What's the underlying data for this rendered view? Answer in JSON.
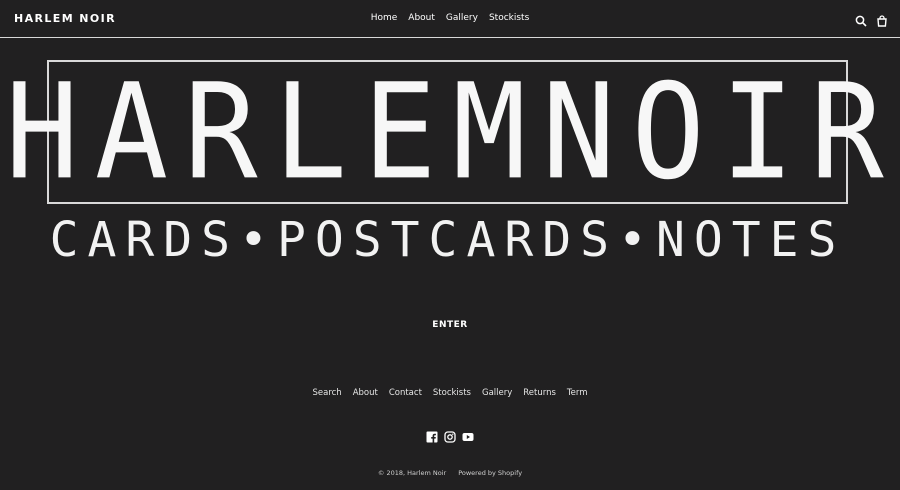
{
  "header": {
    "brand": "HARLEM NOIR",
    "nav": [
      "Home",
      "About",
      "Gallery",
      "Stockists"
    ],
    "icons": [
      "search-icon",
      "cart-icon"
    ]
  },
  "hero": {
    "title": "HARLEMNOIR",
    "subtitle": "CARDS•POSTCARDS•NOTES"
  },
  "enter_label": "ENTER",
  "footer": {
    "links": [
      "Search",
      "About",
      "Contact",
      "Stockists",
      "Gallery",
      "Returns",
      "Term"
    ],
    "social_icons": [
      "facebook-icon",
      "instagram-icon",
      "youtube-icon"
    ],
    "copyright": "© 2018, Harlem Noir",
    "powered_by": "Powered by Shopify"
  },
  "colors": {
    "background": "#212021",
    "text": "#ffffff",
    "border": "#d8d8d8"
  }
}
